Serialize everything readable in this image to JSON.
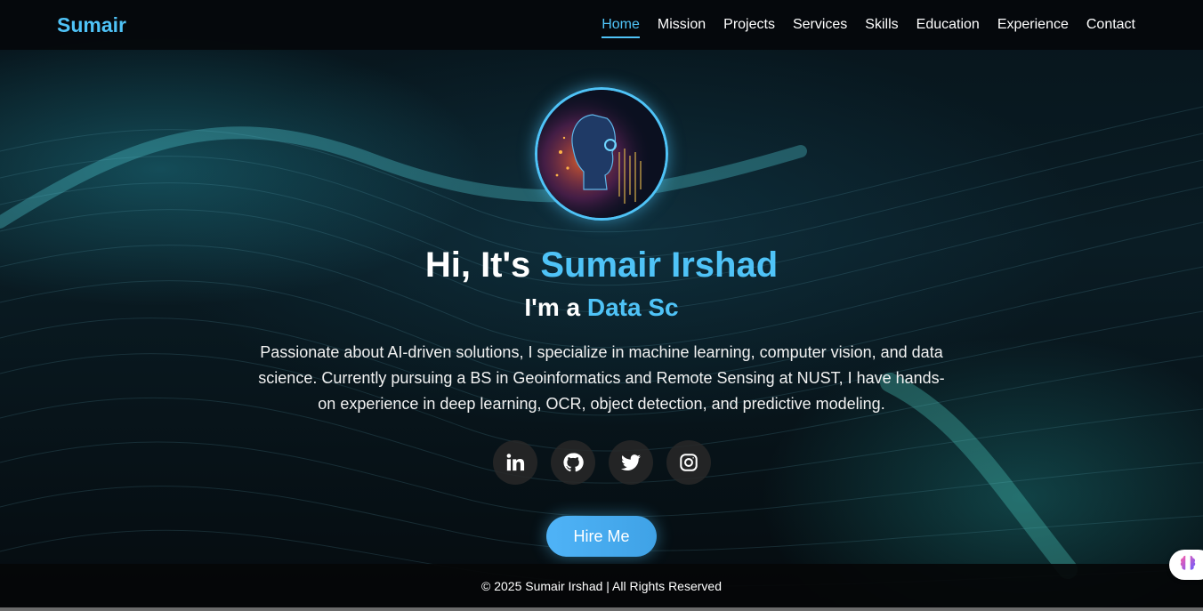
{
  "brand": "Sumair",
  "nav": {
    "items": [
      {
        "label": "Home",
        "active": true
      },
      {
        "label": "Mission"
      },
      {
        "label": "Projects"
      },
      {
        "label": "Services"
      },
      {
        "label": "Skills"
      },
      {
        "label": "Education"
      },
      {
        "label": "Experience"
      },
      {
        "label": "Contact"
      }
    ]
  },
  "hero": {
    "greeting": "Hi, It's ",
    "name": "Sumair Irshad",
    "role_prefix": "I'm a ",
    "role_typed": "Data Sc",
    "description": "Passionate about AI-driven solutions, I specialize in machine learning, computer vision, and data science. Currently pursuing a BS in Geoinformatics and Remote Sensing at NUST, I have hands-on experience in deep learning, OCR, object detection, and predictive modeling.",
    "socials": [
      "linkedin-icon",
      "github-icon",
      "twitter-icon",
      "instagram-icon"
    ],
    "cta": "Hire Me"
  },
  "footer": {
    "text": "© 2025 Sumair Irshad | All Rights Reserved"
  },
  "colors": {
    "accent": "#4fc3f7",
    "header_bg": "#05080b",
    "button": "#4fb3f7"
  }
}
